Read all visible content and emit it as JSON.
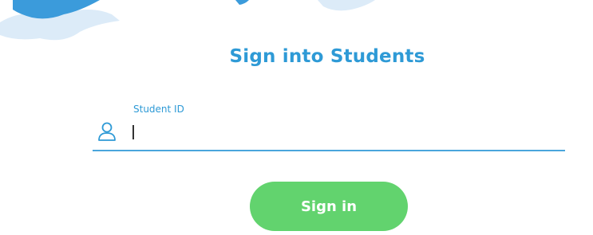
{
  "page": {
    "title": "Sign into Students"
  },
  "login_form": {
    "student_id_label": "Student ID",
    "student_id_value": "",
    "user_icon": "user-icon",
    "signin_label": "Sign in"
  },
  "colors": {
    "accent_blue": "#2e9ad6",
    "underline_blue": "#4aa6dc",
    "button_green": "#62d36e",
    "cloud_blue": "#3b9bdb",
    "cloud_light": "#dcebf8"
  }
}
